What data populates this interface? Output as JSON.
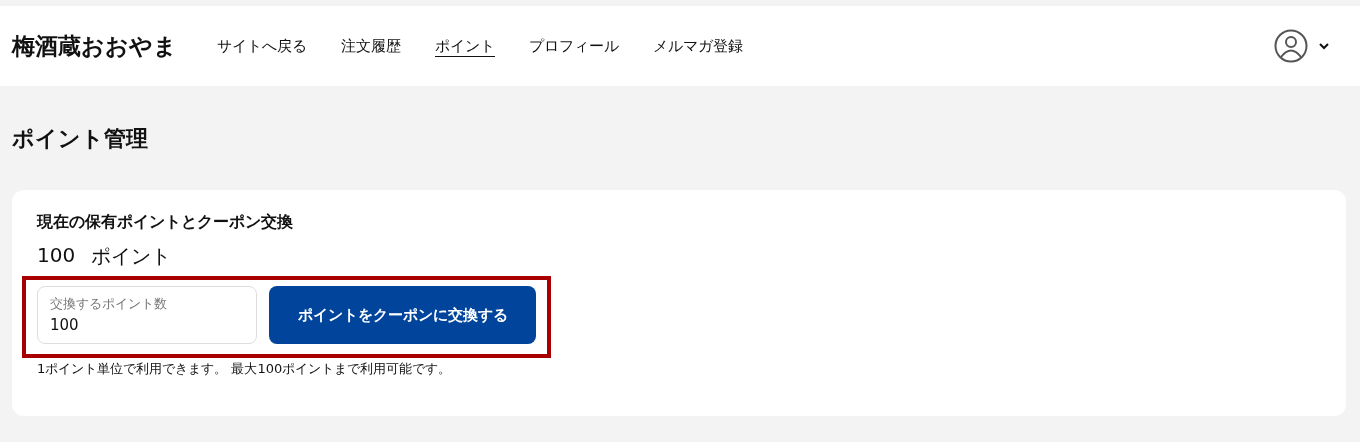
{
  "header": {
    "logo": "梅酒蔵おおやま",
    "nav": [
      {
        "label": "サイトへ戻る",
        "selected": false
      },
      {
        "label": "注文履歴",
        "selected": false
      },
      {
        "label": "ポイント",
        "selected": true
      },
      {
        "label": "プロフィール",
        "selected": false
      },
      {
        "label": "メルマガ登録",
        "selected": false
      }
    ]
  },
  "page_title": "ポイント管理",
  "card": {
    "heading": "現在の保有ポイントとクーポン交換",
    "balance": {
      "value": "100",
      "unit": "ポイント"
    },
    "exchange": {
      "highlighted": true,
      "field": {
        "label": "交換するポイント数",
        "value": "100"
      },
      "button": "ポイントをクーポンに交換する"
    },
    "note": "1ポイント単位で利用できます。 最大100ポイントまで利用可能です。"
  }
}
